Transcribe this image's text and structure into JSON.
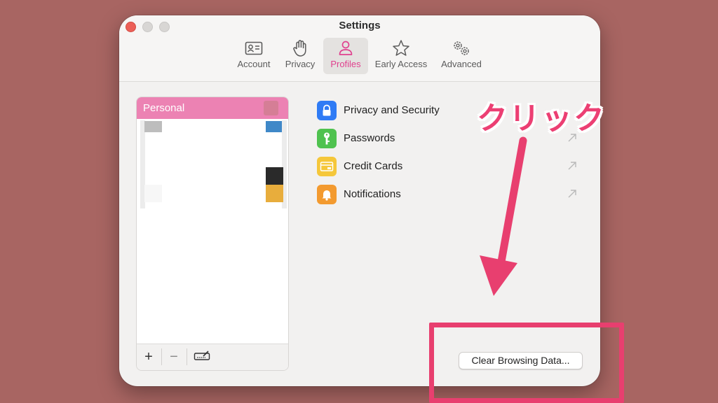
{
  "window": {
    "title": "Settings"
  },
  "tabs": [
    {
      "label": "Account",
      "icon": "contact-card-icon",
      "active": false
    },
    {
      "label": "Privacy",
      "icon": "hand-icon",
      "active": false
    },
    {
      "label": "Profiles",
      "icon": "person-icon",
      "active": true
    },
    {
      "label": "Early Access",
      "icon": "star-icon",
      "active": false
    },
    {
      "label": "Advanced",
      "icon": "gears-icon",
      "active": false
    }
  ],
  "sidebar": {
    "profile_name": "Personal",
    "profile_color": "#ec82b3",
    "footer": {
      "add_label": "+",
      "remove_label": "−",
      "edit_icon": "signature-icon"
    }
  },
  "settings_rows": [
    {
      "label": "Privacy and Security",
      "icon": "lock-icon",
      "color": "#2f7bf5"
    },
    {
      "label": "Passwords",
      "icon": "key-icon",
      "color": "#4fc24f"
    },
    {
      "label": "Credit Cards",
      "icon": "credit-card-icon",
      "color": "#f5c73a"
    },
    {
      "label": "Notifications",
      "icon": "bell-icon",
      "color": "#f39a2f"
    }
  ],
  "clear_button": {
    "label": "Clear Browsing Data..."
  },
  "annotation": {
    "text": "クリック",
    "color": "#e83f6f"
  }
}
